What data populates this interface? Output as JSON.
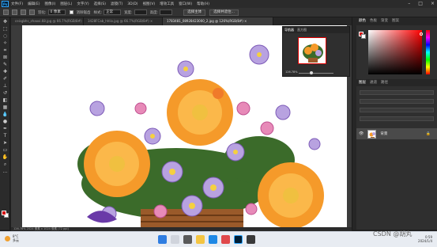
{
  "menubar": {
    "logo": "Ps",
    "items": [
      "文件(F)",
      "编辑(E)",
      "图像(I)",
      "图层(L)",
      "文字(Y)",
      "选择(S)",
      "滤镜(T)",
      "3D(D)",
      "视图(V)",
      "增效工具",
      "窗口(W)",
      "帮助(H)"
    ]
  },
  "options": {
    "feather_label": "羽化:",
    "feather_value": "0 像素",
    "style_label": "样式:",
    "style_value": "正常",
    "width_label": "宽度:",
    "height_label": "高度:",
    "antialias_label": "消除锯齿",
    "select_subject": "选择主体",
    "select_mask": "选择并遮住..."
  },
  "tabs": [
    {
      "label": "ceisgbhs_zhaoxi.68.jpg @ 66.7%(RGB/8#) ×",
      "active": false
    },
    {
      "label": "3428FCab_hhlio.jpg @ 66.7%(RGB/8#) ×",
      "active": false
    },
    {
      "label": "1783481_08928423000_2.jpg @ 126%(RGB/8#) ×",
      "active": true
    }
  ],
  "navigator": {
    "tab1": "导航器",
    "tab2": "直方图",
    "zoom": "126.78%"
  },
  "color_panel": {
    "tab1": "颜色",
    "tab2": "色板",
    "tab3": "渐变",
    "tab4": "图案"
  },
  "layers_panel": {
    "tab1": "图层",
    "tab2": "通道",
    "tab3": "路径",
    "layer_name": "背景",
    "layer_lock": "🔒"
  },
  "status": {
    "text": "126.78%   2024 像素 x 1024 像素 (72 ppi)"
  },
  "taskbar": {
    "weather_temp": "8°C",
    "weather_desc": "多云",
    "time": "0:59",
    "date": "2024/1/4"
  },
  "watermark": "CSDN @胡丸",
  "colors": {
    "foreground": "#d40000",
    "accent": "#31a8ff"
  }
}
